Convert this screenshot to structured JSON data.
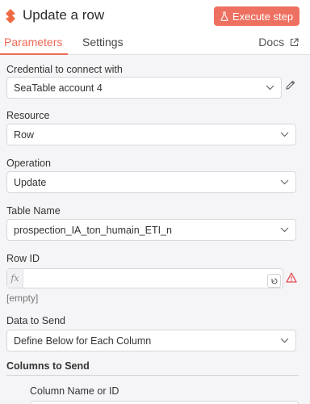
{
  "header": {
    "title": "Update a row",
    "execute_label": "Execute step"
  },
  "tabs": {
    "parameters": "Parameters",
    "settings": "Settings",
    "docs": "Docs"
  },
  "credential": {
    "label": "Credential to connect with",
    "value": "SeaTable account 4"
  },
  "resource": {
    "label": "Resource",
    "value": "Row"
  },
  "operation": {
    "label": "Operation",
    "value": "Update"
  },
  "table_name": {
    "label": "Table Name",
    "value": "prospection_IA_ton_humain_ETI_n"
  },
  "row_id": {
    "label": "Row ID",
    "fx": "fx",
    "value": "",
    "hint": "[empty]"
  },
  "data_to_send": {
    "label": "Data to Send",
    "value": "Define Below for Each Column"
  },
  "columns": {
    "heading": "Columns to Send",
    "column_label": "Column Name or ID"
  },
  "colors": {
    "accent": "#ee6a55",
    "button": "#ee7060",
    "warning": "#e5484d"
  }
}
